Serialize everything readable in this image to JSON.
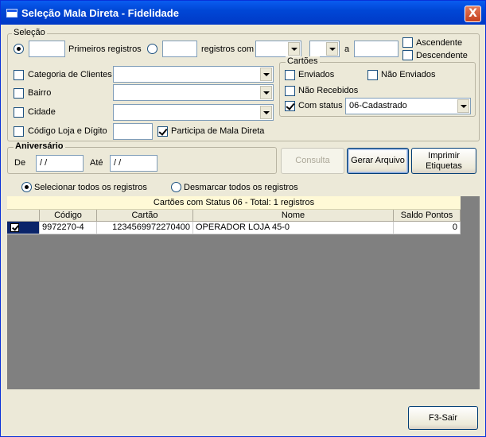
{
  "window": {
    "title": "Seleção Mala Direta - Fidelidade",
    "close_label": "X"
  },
  "selecao": {
    "legend": "Seleção",
    "primeiros_value": "",
    "primeiros_label": "Primeiros registros",
    "registros_com_value": "",
    "registros_com_label": "registros com",
    "combo1_value": "",
    "combo2_value": "",
    "a_label": "a",
    "a_value": "",
    "ascendente_label": "Ascendente",
    "descendente_label": "Descendente",
    "categoria_label": "Categoria de Clientes",
    "categoria_value": "",
    "bairro_label": "Bairro",
    "bairro_value": "",
    "cidade_label": "Cidade",
    "cidade_value": "",
    "codigo_loja_label": "Código Loja e Dígito",
    "codigo_loja_value": "",
    "participa_label": "Participa de Mala Direta"
  },
  "cartoes": {
    "legend": "Cartões",
    "enviados_label": "Enviados",
    "nao_enviados_label": "Não Enviados",
    "nao_recebidos_label": "Não Recebidos",
    "com_status_label": "Com status",
    "status_value": "06-Cadastrado"
  },
  "aniversario": {
    "legend": "Aniversário",
    "de_label": "De",
    "de_value": " /  /",
    "ate_label": "Até",
    "ate_value": " /  /"
  },
  "buttons": {
    "consulta": "Consulta",
    "gerar_arquivo": "Gerar Arquivo",
    "imprimir_line1": "Imprimir",
    "imprimir_line2": "Etiquetas",
    "sair": "F3-Sair"
  },
  "selection_radios": {
    "selecionar_todos": "Selecionar todos os registros",
    "desmarcar_todos": "Desmarcar todos os registros"
  },
  "grid": {
    "caption": "Cartões com Status 06 - Total: 1 registros",
    "columns": [
      "",
      "Código",
      "Cartão",
      "Nome",
      "Saldo Pontos"
    ],
    "rows": [
      {
        "checked": true,
        "codigo": "9972270-4",
        "cartao": "1234569972270400",
        "nome": "OPERADOR LOJA 45-0",
        "saldo": "0"
      }
    ]
  }
}
